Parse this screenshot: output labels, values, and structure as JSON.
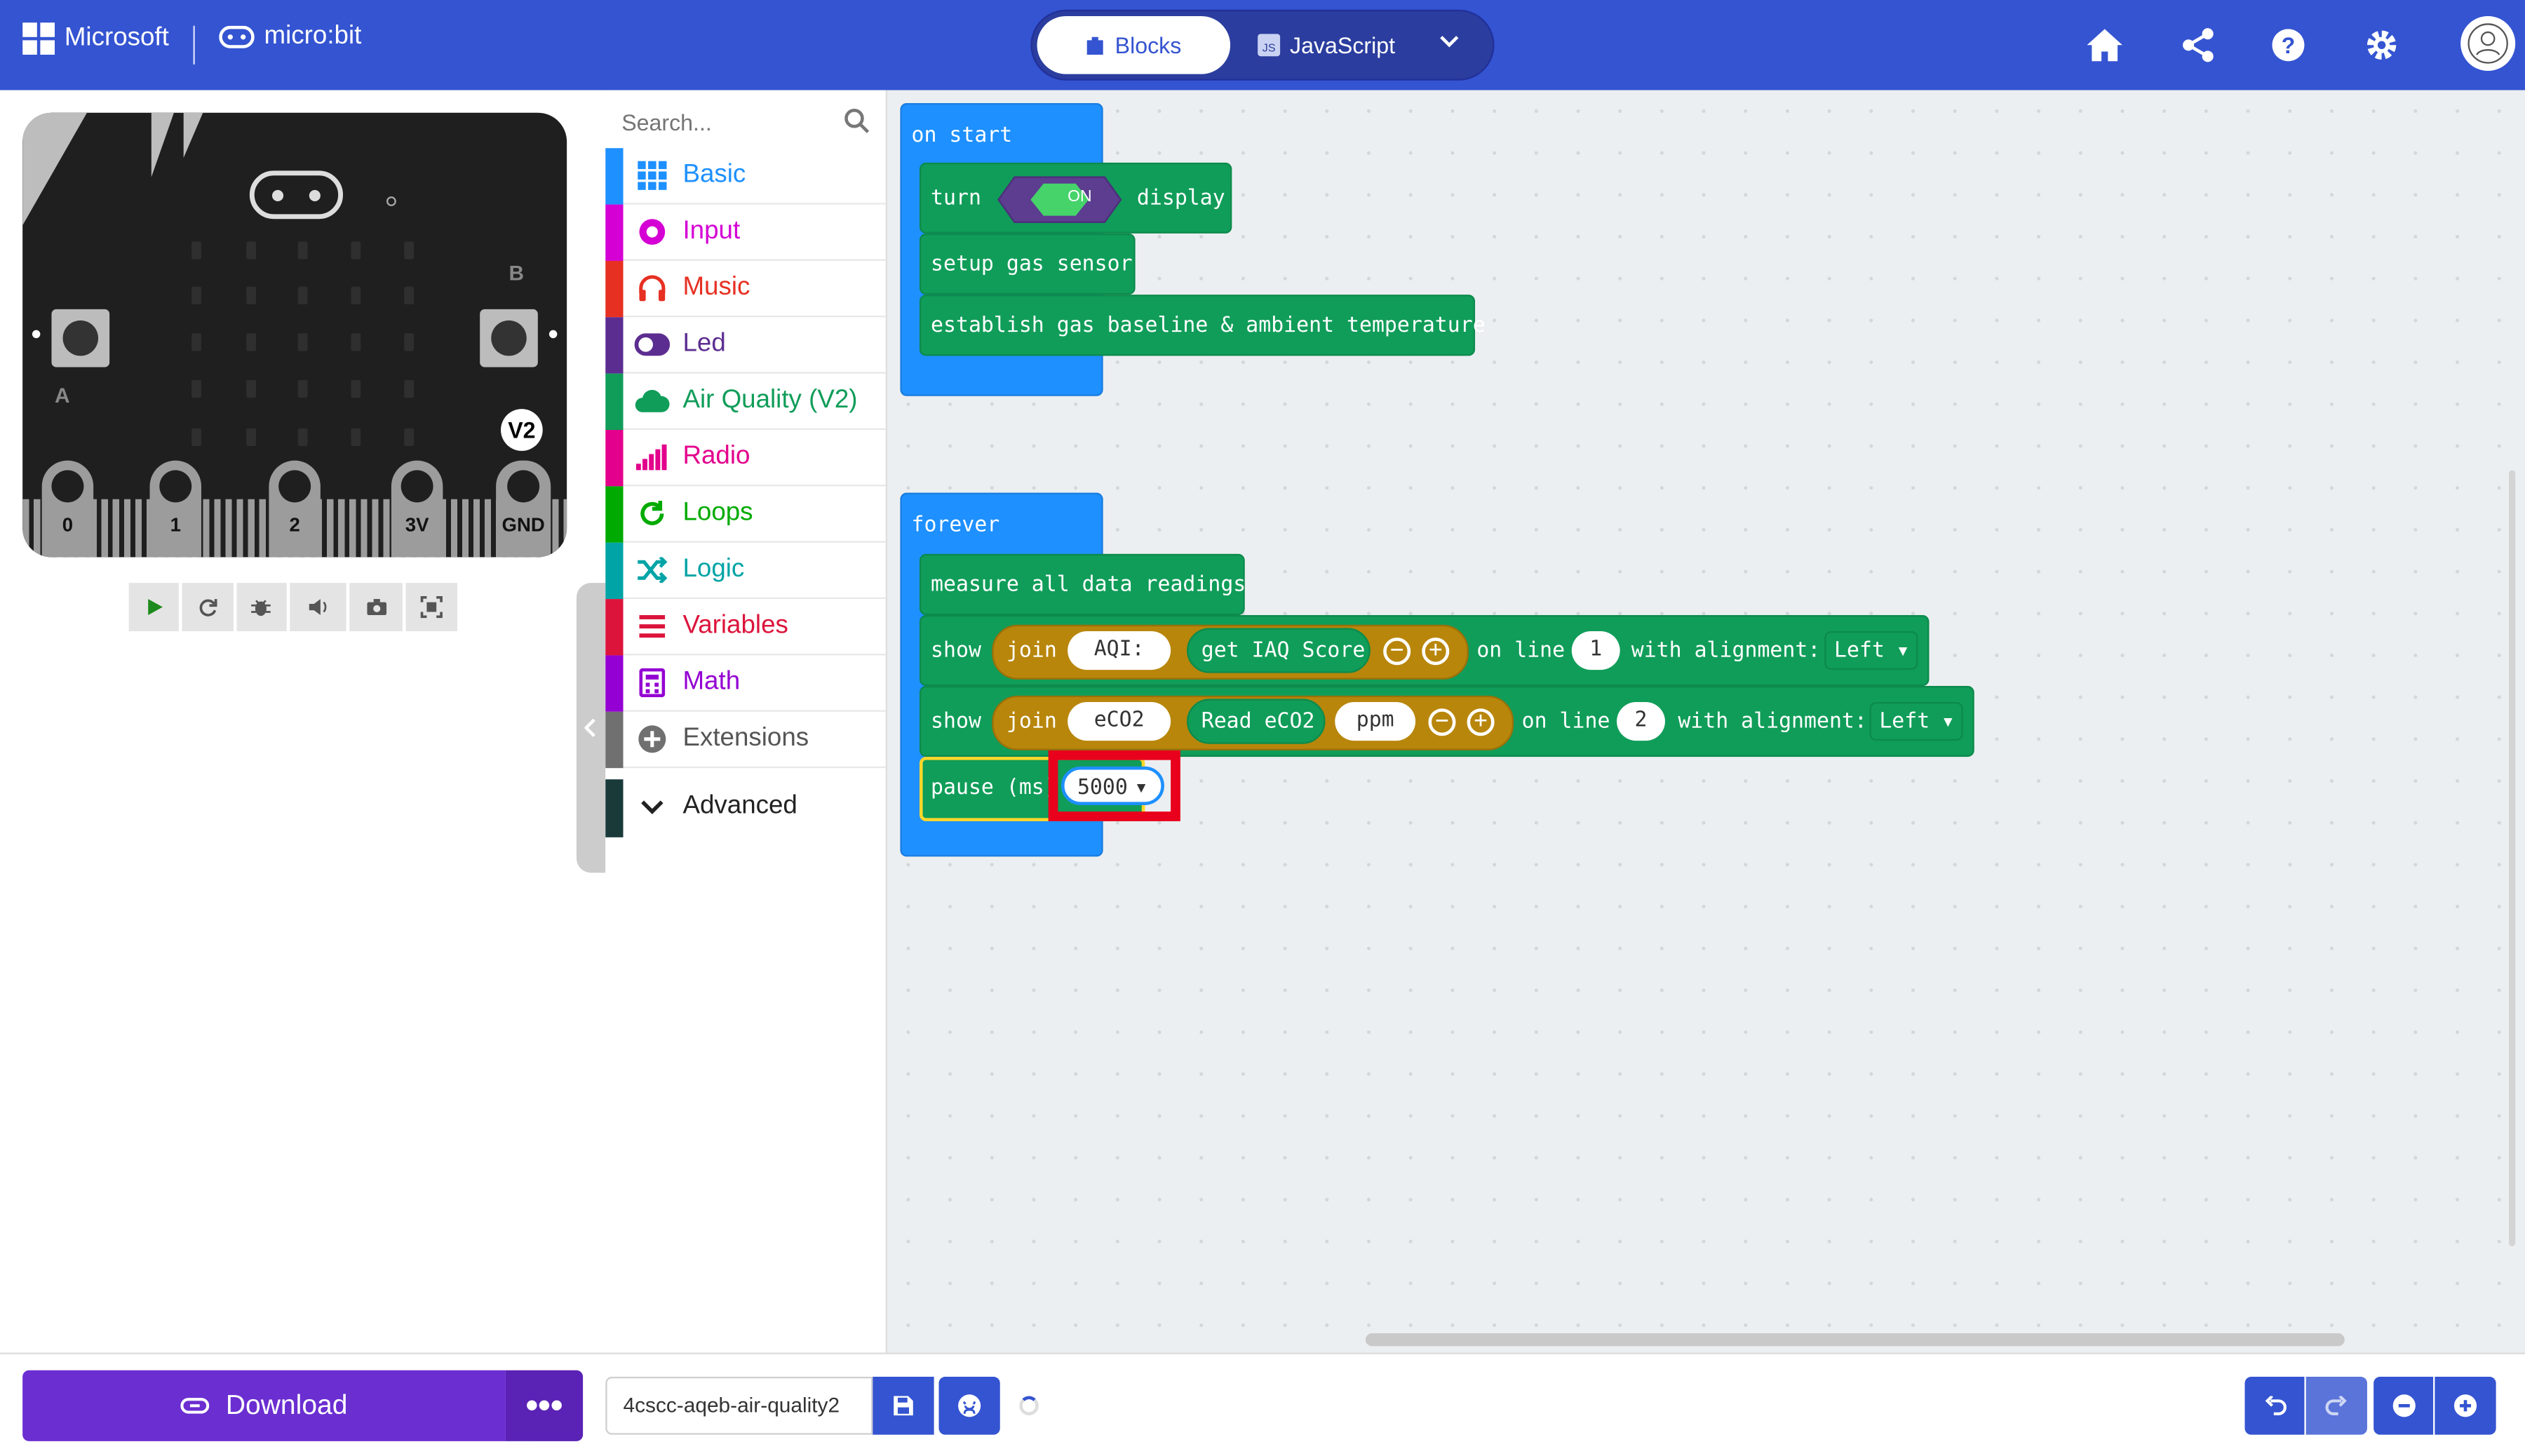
{
  "header": {
    "brand": "Microsoft",
    "product": "micro:bit",
    "tabs": {
      "blocks": "Blocks",
      "javascript": "JavaScript"
    },
    "icons": [
      "home-icon",
      "share-icon",
      "help-icon",
      "settings-icon",
      "avatar"
    ]
  },
  "simulator": {
    "pins": [
      "0",
      "1",
      "2",
      "3V",
      "GND"
    ],
    "button_a": "A",
    "button_b": "B",
    "version_badge": "V2"
  },
  "toolbox": {
    "search_placeholder": "Search...",
    "categories": [
      {
        "label": "Basic",
        "color": "#1e90ff",
        "icon": "grid-icon"
      },
      {
        "label": "Input",
        "color": "#d400d4",
        "icon": "target-icon"
      },
      {
        "label": "Music",
        "color": "#e63022",
        "icon": "headphones-icon"
      },
      {
        "label": "Led",
        "color": "#5c2d91",
        "icon": "toggle-icon"
      },
      {
        "label": "Air Quality (V2)",
        "color": "#109d59",
        "icon": "cloud-icon"
      },
      {
        "label": "Radio",
        "color": "#e3008c",
        "icon": "signal-icon"
      },
      {
        "label": "Loops",
        "color": "#00aa00",
        "icon": "refresh-icon"
      },
      {
        "label": "Logic",
        "color": "#00a4a6",
        "icon": "shuffle-icon"
      },
      {
        "label": "Variables",
        "color": "#dc143c",
        "icon": "list-icon"
      },
      {
        "label": "Math",
        "color": "#9400d3",
        "icon": "calculator-icon"
      },
      {
        "label": "Extensions",
        "color": "#707070",
        "icon": "plus-circle-icon"
      },
      {
        "label": "Advanced",
        "color": "#1a3a3a",
        "icon": "chevron-down-icon"
      }
    ]
  },
  "workspace": {
    "on_start": {
      "hat": "on start",
      "turn": "turn",
      "toggle": "ON",
      "display": "display",
      "setup": "setup gas sensor",
      "establish": "establish gas baseline & ambient temperature"
    },
    "forever": {
      "hat": "forever",
      "measure": "measure all data readings",
      "show1": {
        "show": "show",
        "join": "join",
        "text": "AQI: ",
        "func": "get IAQ Score",
        "on_line": "on line",
        "line": "1",
        "with_alignment": "with alignment:",
        "alignment": "Left"
      },
      "show2": {
        "show": "show",
        "join": "join",
        "text": "eCO2",
        "func": "Read eCO2",
        "text2": "ppm",
        "on_line": "on line",
        "line": "2",
        "with_alignment": "with alignment:",
        "alignment": "Left"
      },
      "pause": {
        "label": "pause (ms)",
        "value": "5000"
      }
    },
    "highlight_color": "#e8001c"
  },
  "bottombar": {
    "download": "Download",
    "more": "•••",
    "project_name": "4cscc-aqeb-air-quality2"
  }
}
